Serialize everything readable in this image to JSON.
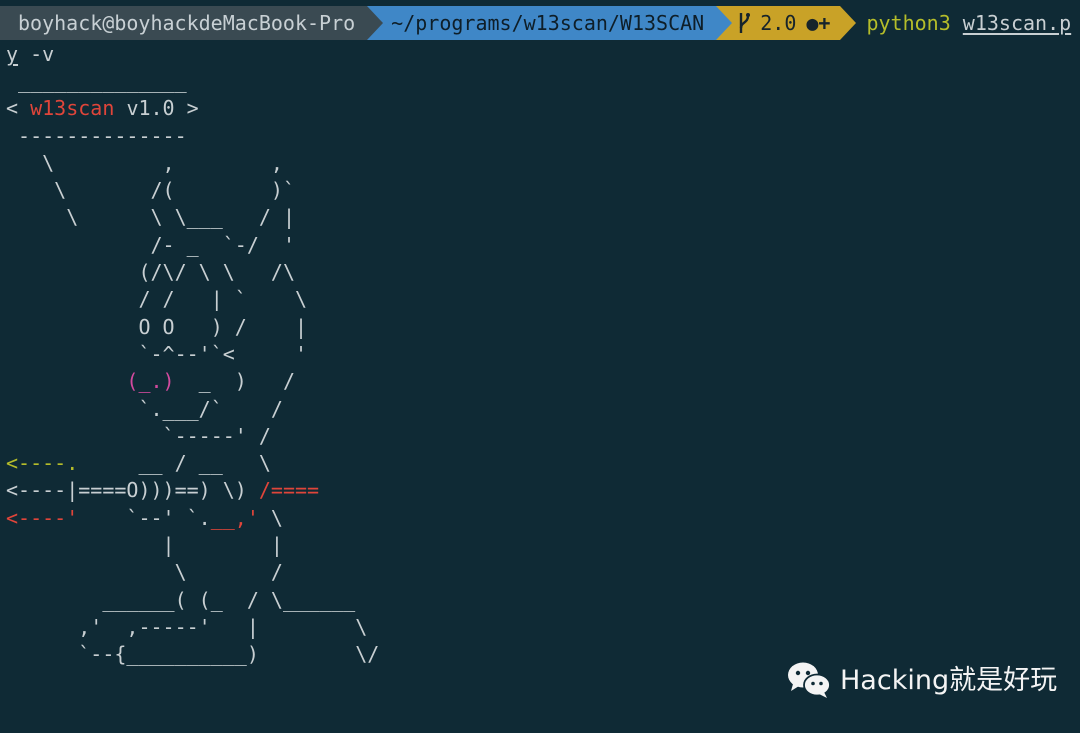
{
  "prompt": {
    "user_host": "boyhack@boyhackdeMacBook-Pro",
    "path": "~/programs/w13scan/W13SCAN",
    "git_version": "2.0",
    "git_dirty_icon": "●+",
    "command": "python3",
    "command_arg": "w13scan.p",
    "command_cont_u": "y",
    "command_cont_rest": " -v"
  },
  "banner": {
    "title": "w13scan",
    "version": "v1.0"
  },
  "art": {
    "l01": " ______________",
    "l02a": "< ",
    "l02b": " ",
    "l02c": " >",
    "l03": " --------------",
    "l04": "   \\         ,        ,",
    "l05": "    \\       /(        )`",
    "l06": "     \\      \\ \\___   / |",
    "l07": "            /- _  `-/  '",
    "l08": "           (/\\/ \\ \\   /\\",
    "l09": "           / /   | `    \\",
    "l10": "           O O   ) /    |",
    "l11": "           `-^--'`<     '",
    "l12a": "          ",
    "l12b": "(_.)",
    "l12c": "  _  )   /",
    "l13": "           `.___/`    /",
    "l14": "             `-----' /",
    "l15a": "<----.",
    "l15b": "     __ / __   \\",
    "l16a": "<----|====O)))==) \\) ",
    "l16b": "/====",
    "l17a": "<----'",
    "l17b": "    `--' `.",
    "l17c": "__,'",
    "l17d": " \\",
    "l18": "             |        |",
    "l19": "              \\       /",
    "l20": "        ______( (_  / \\______",
    "l21": "      ,'  ,-----'   |        \\",
    "l22": "      `--{__________)        \\/"
  },
  "watermark": {
    "text": "Hacking就是好玩",
    "icon": "wechat-icon"
  },
  "colors": {
    "background": "#0f2a35",
    "user_segment": "#3a4a52",
    "path_segment": "#3f87c7",
    "git_segment": "#c9a227",
    "command": "#b5bd2a",
    "red": "#e0453a",
    "pink": "#d24a9e"
  }
}
